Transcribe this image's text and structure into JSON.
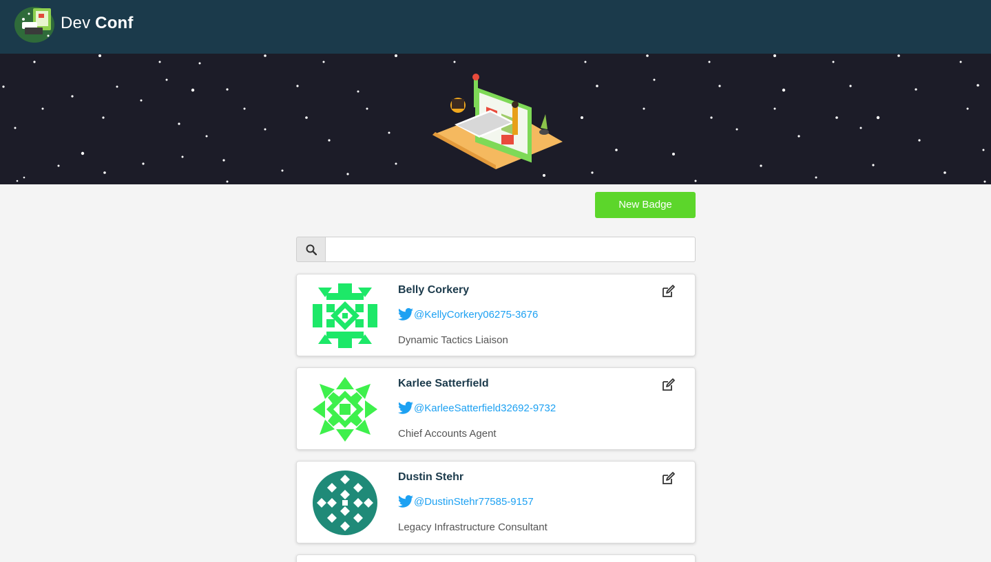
{
  "navbar": {
    "brand_light": "Dev",
    "brand_bold": "Conf",
    "logo_icon": "devconf-logo-icon"
  },
  "hero": {
    "illustration": "hero-computer-illustration"
  },
  "actions": {
    "new_badge_label": "New Badge"
  },
  "search": {
    "placeholder": "",
    "value": "",
    "icon": "search-icon"
  },
  "badges": [
    {
      "name": "Belly Corkery",
      "twitter": "@KellyCorkery06275-3676",
      "job_title": "Dynamic Tactics Liaison",
      "avatar_color": "#1de868"
    },
    {
      "name": "Karlee Satterfield",
      "twitter": "@KarleeSatterfield32692-9732",
      "job_title": "Chief Accounts Agent",
      "avatar_color": "#3ef04c"
    },
    {
      "name": "Dustin Stehr",
      "twitter": "@DustinStehr77585-9157",
      "job_title": "Legacy Infrastructure Consultant",
      "avatar_color": "#1f8a78"
    }
  ],
  "colors": {
    "navbar": "#1b3a4b",
    "hero_bg": "#1c1c28",
    "primary_button": "#5cd62b",
    "twitter_link": "#1da1f2",
    "badge_name": "#1b3a4b"
  }
}
